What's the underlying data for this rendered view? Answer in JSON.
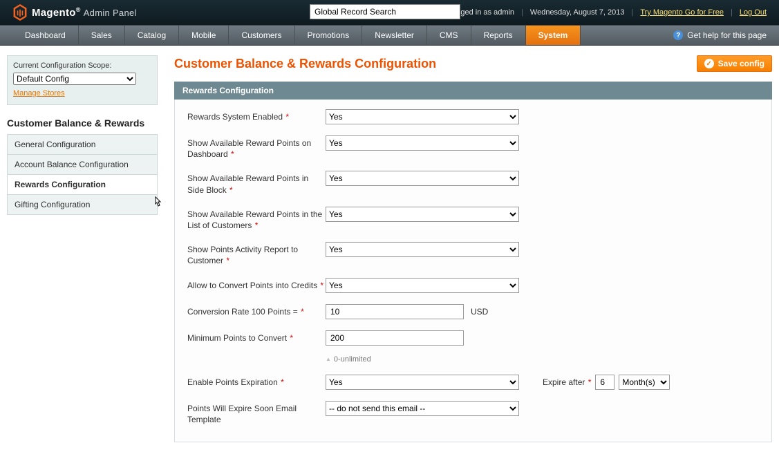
{
  "header": {
    "brand": "Magento",
    "panel": "Admin Panel",
    "search_placeholder": "Global Record Search",
    "logged_in": "Logged in as admin",
    "date": "Wednesday, August 7, 2013",
    "try_link": "Try Magento Go for Free",
    "logout": "Log Out"
  },
  "nav": {
    "items": [
      "Dashboard",
      "Sales",
      "Catalog",
      "Mobile",
      "Customers",
      "Promotions",
      "Newsletter",
      "CMS",
      "Reports",
      "System"
    ],
    "active_index": 9,
    "help": "Get help for this page"
  },
  "sidebar": {
    "scope_label": "Current Configuration Scope:",
    "scope_value": "Default Config",
    "manage_stores": "Manage Stores",
    "title": "Customer Balance & Rewards",
    "menu": [
      {
        "label": "General Configuration",
        "active": false
      },
      {
        "label": "Account Balance Configuration",
        "active": false
      },
      {
        "label": "Rewards Configuration",
        "active": true
      },
      {
        "label": "Gifting Configuration",
        "active": false
      }
    ]
  },
  "page": {
    "title": "Customer Balance & Rewards Configuration",
    "save": "Save config",
    "section_title": "Rewards Configuration"
  },
  "form": {
    "rows": [
      {
        "label": "Rewards System Enabled",
        "req": true,
        "type": "select",
        "value": "Yes"
      },
      {
        "label": "Show Available Reward Points on Dashboard",
        "req": true,
        "type": "select",
        "value": "Yes"
      },
      {
        "label": "Show Available Reward Points in Side Block",
        "req": true,
        "type": "select",
        "value": "Yes"
      },
      {
        "label": "Show Available Reward Points in the List of Customers",
        "req": true,
        "type": "select",
        "value": "Yes"
      },
      {
        "label": "Show Points Activity Report to Customer",
        "req": true,
        "type": "select",
        "value": "Yes"
      },
      {
        "label": "Allow to Convert Points into Credits",
        "req": true,
        "type": "select",
        "value": "Yes"
      },
      {
        "label": "Conversion Rate 100 Points =",
        "req": true,
        "type": "text",
        "value": "10",
        "suffix": "USD"
      },
      {
        "label": "Minimum Points to Convert",
        "req": true,
        "type": "text",
        "value": "200",
        "note": "0-unlimited"
      },
      {
        "label": "Enable Points Expiration",
        "req": true,
        "type": "select",
        "value": "Yes",
        "extra_label": "Expire after",
        "extra_req": true,
        "extra_value": "6",
        "extra_unit": "Month(s)"
      },
      {
        "label": "Points Will Expire Soon Email Template",
        "req": false,
        "type": "select",
        "value": "-- do not send this email --"
      }
    ]
  }
}
